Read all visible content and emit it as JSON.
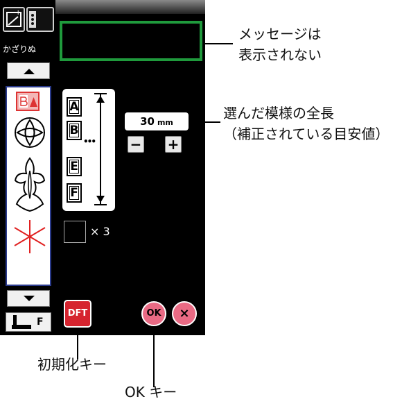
{
  "sidebar": {
    "category_label": "かざりぬ",
    "foot_label": "F"
  },
  "pattern_sequence": [
    "A",
    "B",
    "E",
    "F"
  ],
  "length": {
    "value": "30",
    "unit": "mm"
  },
  "controls": {
    "minus": "−",
    "plus": "+"
  },
  "repeat": {
    "label": "× 3"
  },
  "buttons": {
    "dft": "DFT",
    "ok": "OK",
    "close": "×"
  },
  "callouts": {
    "message_line1": "メッセージは",
    "message_line2": "表示されない",
    "length_line1": "選んだ模様の全長",
    "length_line2": "（補正されている目安値）",
    "dft": "初期化キー",
    "ok": "OK キー"
  },
  "colors": {
    "message_border": "#1f9a3c",
    "dft_red": "#d6242f",
    "ok_pink": "#e96a84"
  }
}
